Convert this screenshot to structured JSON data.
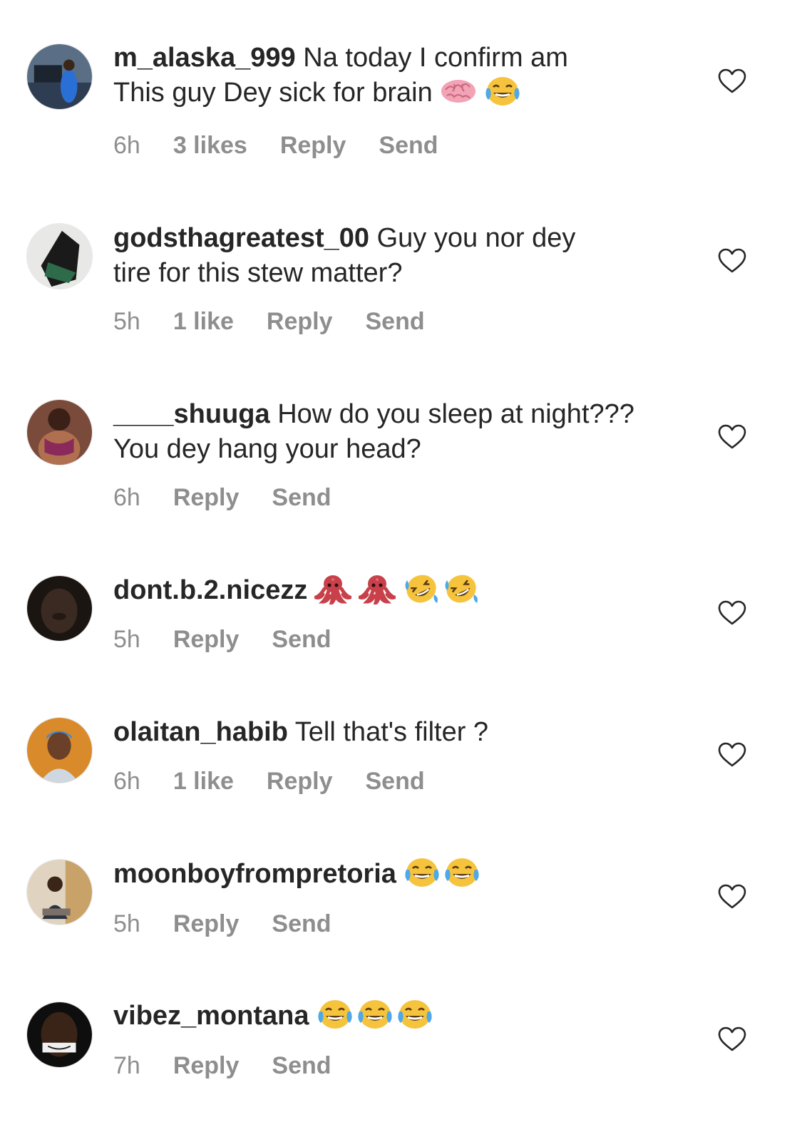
{
  "comments": [
    {
      "username": "m_alaska_999",
      "text_line1": "Na today I confirm am",
      "text_line2": "This guy Dey sick for brain",
      "emojis": [
        "brain-emoji",
        "tears-of-joy-emoji"
      ],
      "time": "6h",
      "likes": "3 likes",
      "reply_label": "Reply",
      "send_label": "Send"
    },
    {
      "username": "godsthagreatest_00",
      "text_line1": "Guy you nor dey",
      "text_line2": "tire for this stew matter?",
      "time": "5h",
      "likes": "1 like",
      "reply_label": "Reply",
      "send_label": "Send"
    },
    {
      "username": "____shuuga",
      "text_line1": "How do you sleep at night???",
      "text_line2": "You dey hang your head?",
      "time": "6h",
      "reply_label": "Reply",
      "send_label": "Send"
    },
    {
      "username": "dont.b.2.nicezz",
      "emojis": [
        "octopus-emoji",
        "octopus-emoji",
        "rolling-on-floor-laughing-emoji",
        "rolling-on-floor-laughing-emoji"
      ],
      "time": "5h",
      "reply_label": "Reply",
      "send_label": "Send"
    },
    {
      "username": "olaitan_habib",
      "text_line1": "Tell that's filter ?",
      "time": "6h",
      "likes": "1 like",
      "reply_label": "Reply",
      "send_label": "Send"
    },
    {
      "username": "moonboyfrompretoria",
      "emojis": [
        "tears-of-joy-emoji",
        "tears-of-joy-emoji"
      ],
      "time": "5h",
      "reply_label": "Reply",
      "send_label": "Send"
    },
    {
      "username": "vibez_montana",
      "emojis": [
        "tears-of-joy-emoji",
        "tears-of-joy-emoji",
        "tears-of-joy-emoji"
      ],
      "time": "7h",
      "reply_label": "Reply",
      "send_label": "Send"
    }
  ],
  "icons": {
    "like": "heart-outline-icon"
  },
  "colors": {
    "text": "#262626",
    "meta": "#8e8e8e",
    "background": "#ffffff"
  }
}
